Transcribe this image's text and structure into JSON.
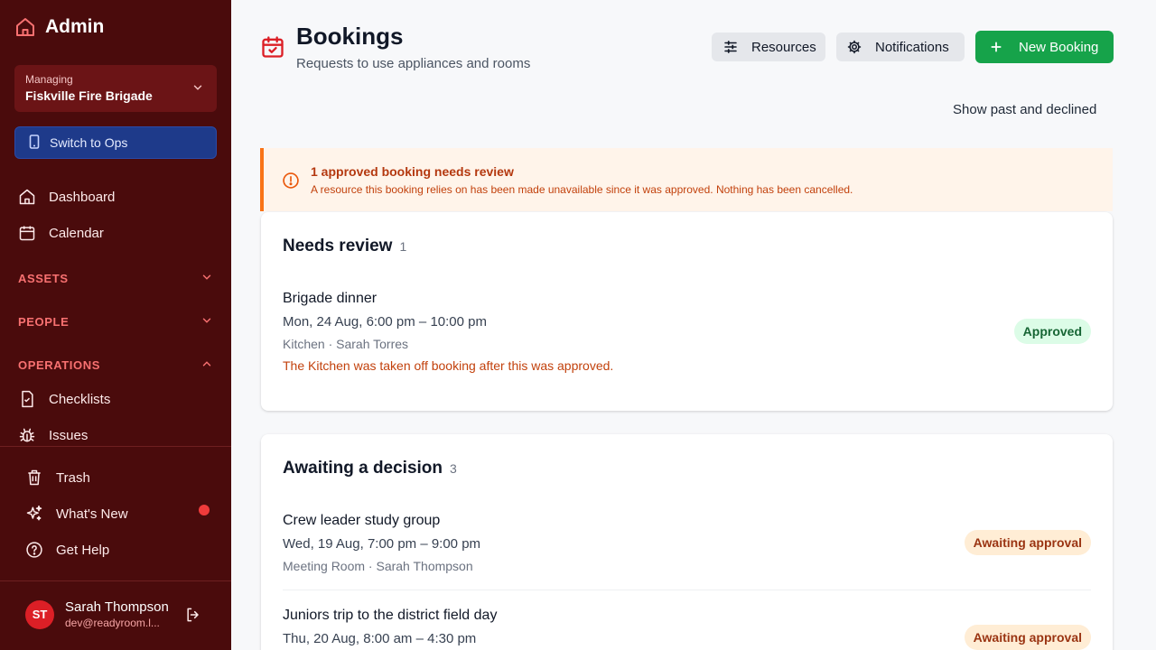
{
  "sidebar": {
    "brand": "Admin",
    "org_caption": "Managing",
    "org_name": "Fiskville Fire Brigade",
    "switch_label": "Switch to Ops",
    "nav": {
      "dashboard": "Dashboard",
      "calendar": "Calendar",
      "checklists": "Checklists",
      "issues": "Issues"
    },
    "sections": {
      "assets": "ASSETS",
      "people": "PEOPLE",
      "operations": "OPERATIONS"
    },
    "footer": {
      "trash": "Trash",
      "whats_new": "What's New",
      "get_help": "Get Help"
    },
    "user": {
      "initials": "ST",
      "name": "Sarah Thompson",
      "email": "dev@readyroom.l..."
    }
  },
  "header": {
    "title": "Bookings",
    "subtitle": "Requests to use appliances and rooms",
    "resources_label": "Resources",
    "notifications_label": "Notifications",
    "new_booking_label": "New Booking",
    "show_past_label": "Show past and declined"
  },
  "alert": {
    "title": "1 approved booking needs review",
    "text": "A resource this booking relies on has been made unavailable since it was approved. Nothing has been cancelled."
  },
  "needs_review": {
    "title": "Needs review",
    "count": "1",
    "items": [
      {
        "title": "Brigade dinner",
        "time": "Mon, 24 Aug, 6:00 pm – 10:00 pm",
        "meta": "Kitchen · Sarah Torres",
        "warning": "The Kitchen was taken off booking after this was approved.",
        "status": "Approved"
      }
    ]
  },
  "awaiting": {
    "title": "Awaiting a decision",
    "count": "3",
    "items": [
      {
        "title": "Crew leader study group",
        "time": "Wed, 19 Aug, 7:00 pm – 9:00 pm",
        "meta": "Meeting Room · Sarah Thompson",
        "status": "Awaiting approval"
      },
      {
        "title": "Juniors trip to the district field day",
        "time": "Thu, 20 Aug, 8:00 am – 4:30 pm",
        "status": "Awaiting approval"
      }
    ]
  },
  "colors": {
    "sidebar_bg": "#4a0b0c",
    "accent_red": "#dc1f26",
    "primary_green": "#16a34a",
    "alert_orange": "#f97316"
  }
}
